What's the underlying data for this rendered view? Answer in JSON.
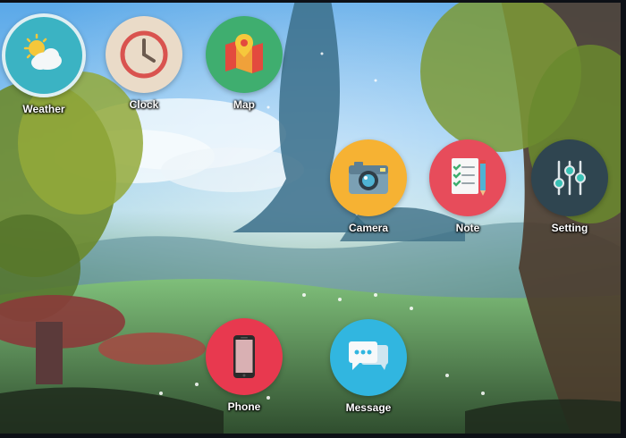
{
  "home_screen": {
    "apps": [
      {
        "id": "weather",
        "label": "Weather",
        "icon": "weather-icon",
        "color": "#3bb3c3"
      },
      {
        "id": "clock",
        "label": "Clock",
        "icon": "clock-icon",
        "color": "#eadbc8"
      },
      {
        "id": "map",
        "label": "Map",
        "icon": "map-icon",
        "color": "#3fae6f"
      },
      {
        "id": "camera",
        "label": "Camera",
        "icon": "camera-icon",
        "color": "#f6b233"
      },
      {
        "id": "note",
        "label": "Note",
        "icon": "note-icon",
        "color": "#e74c5b"
      },
      {
        "id": "setting",
        "label": "Setting",
        "icon": "setting-icon",
        "color": "#2f4550"
      },
      {
        "id": "phone",
        "label": "Phone",
        "icon": "phone-icon",
        "color": "#e8394f"
      },
      {
        "id": "message",
        "label": "Message",
        "icon": "message-icon",
        "color": "#31b6e0"
      }
    ]
  }
}
